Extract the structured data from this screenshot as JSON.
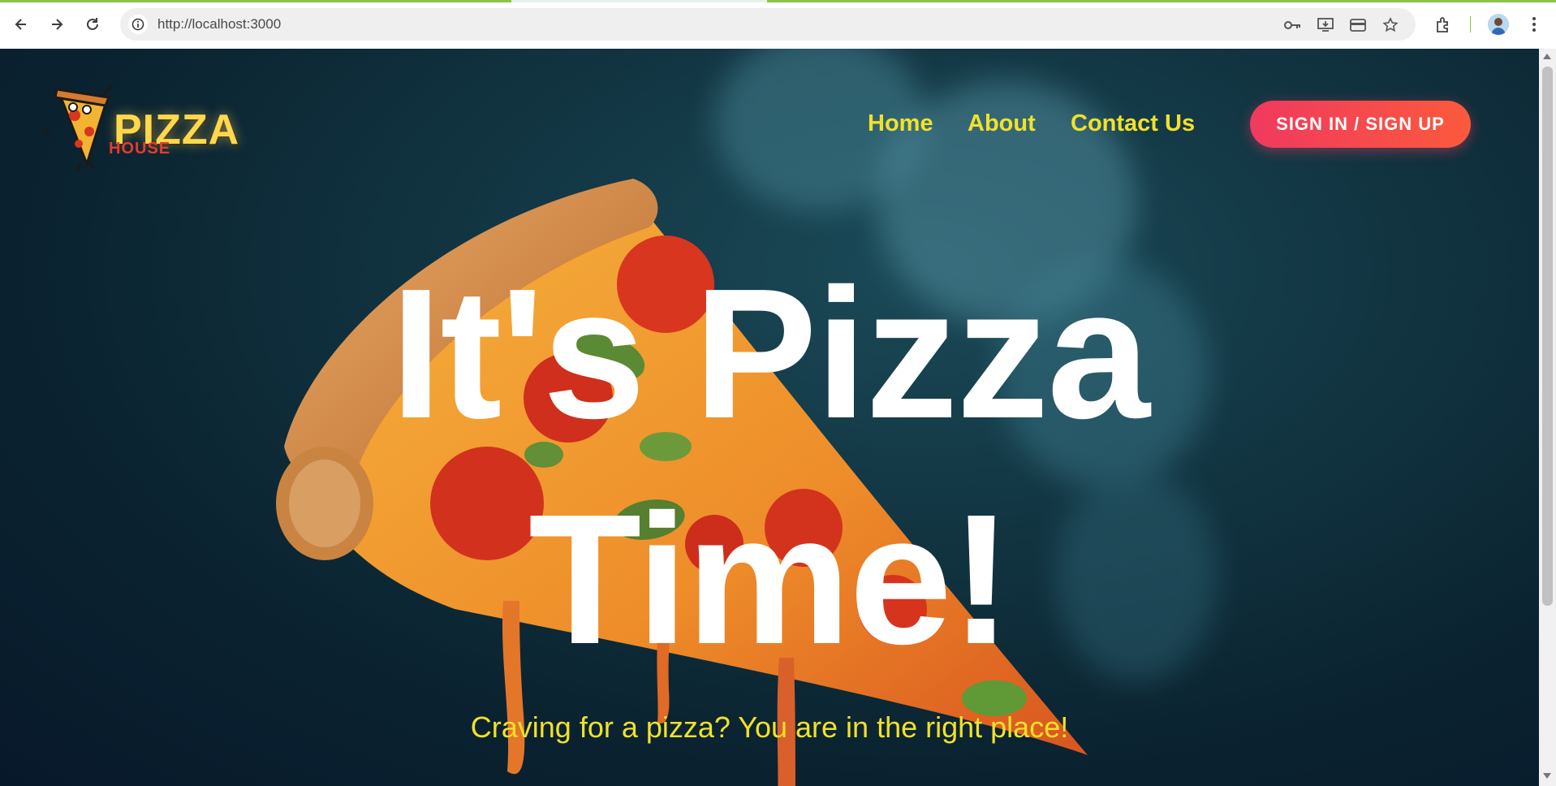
{
  "browser": {
    "url": "http://localhost:3000",
    "icons": [
      "back-icon",
      "forward-icon",
      "reload-icon",
      "site-info-icon",
      "password-key-icon",
      "install-app-icon",
      "payment-card-icon",
      "bookmark-star-icon",
      "extensions-icon",
      "profile-avatar",
      "menu-kebab-icon"
    ]
  },
  "header": {
    "logo_title": "PIZZA",
    "logo_subtitle": "HOUSE",
    "nav": [
      {
        "label": "Home"
      },
      {
        "label": "About"
      },
      {
        "label": "Contact Us"
      }
    ],
    "cta_label": "SIGN IN / SIGN UP"
  },
  "hero": {
    "title_line1": "It's Pizza",
    "title_line2": "Time!",
    "subtitle": "Craving for a pizza? You are in the right place!"
  },
  "colors": {
    "nav_text": "#f2e12a",
    "cta_start": "#f0395f",
    "cta_end": "#fb5a3c",
    "hero_text": "#ffffff",
    "background": "#0b2431"
  }
}
